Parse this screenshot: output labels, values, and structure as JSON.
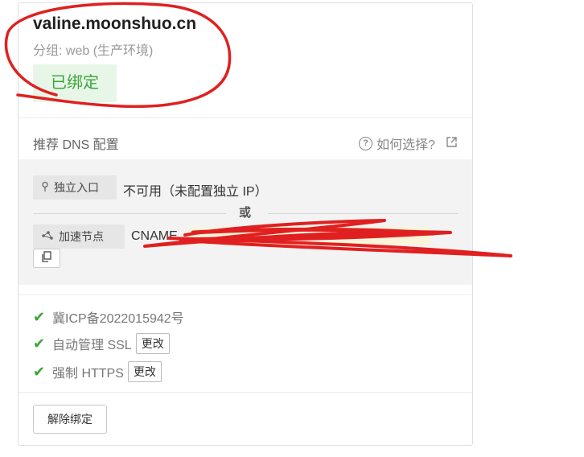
{
  "domain": {
    "name": "valine.moonshuo.cn",
    "group": "分组: web (生产环境)",
    "bound_status": "已绑定"
  },
  "dns": {
    "title": "推荐 DNS 配置",
    "help_link": "如何选择?",
    "dedicated_entry": {
      "tag": "独立入口",
      "value": "不可用（未配置独立 IP）"
    },
    "or_label": "或",
    "accelerate_node": {
      "tag": "加速节点",
      "record_type": "CNAME"
    }
  },
  "status": {
    "icp": "冀ICP备2022015942号",
    "ssl": "自动管理 SSL",
    "https": "强制 HTTPS",
    "change_label": "更改"
  },
  "actions": {
    "unbind_label": "解除绑定"
  },
  "colors": {
    "green": "#3aa53a",
    "badge_bg": "#e8f6e8",
    "annotation_red": "#e02020"
  }
}
